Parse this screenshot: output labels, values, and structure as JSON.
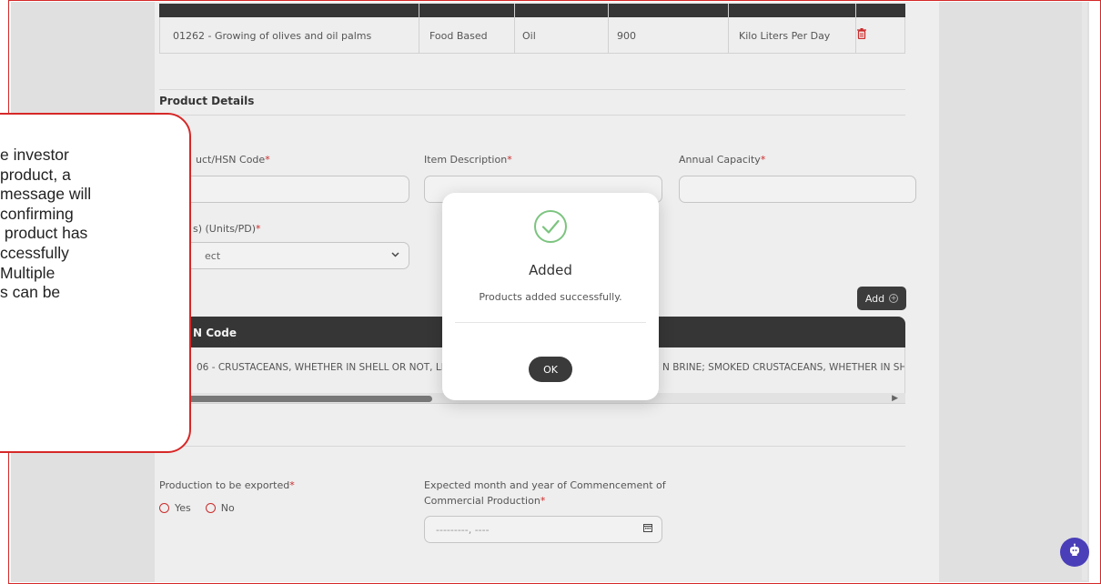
{
  "top_table": {
    "row": {
      "nic_code": "01262 - Growing of olives and oil palms",
      "category": "Food Based",
      "product": "Oil",
      "capacity": "900",
      "unit": "Kilo Liters Per Day"
    }
  },
  "product_details": {
    "title": "Product Details",
    "fields": {
      "hsn_label": "uct/HSN Code",
      "item_description_label": "Item Description",
      "annual_capacity_label": "Annual Capacity",
      "units_label": "s) (Units/PD)",
      "units_select_value": "ect",
      "required_marker": "*"
    },
    "add_button_label": "Add",
    "table": {
      "header": "N Code",
      "row_text_left": "06 - CRUSTACEANS, WHETHER IN SHELL OR NOT, LIVE,",
      "row_text_right": "N BRINE; SMOKED CRUSTACEANS, WHETHER IN SHELL C"
    }
  },
  "export": {
    "label": "Production to be exported",
    "options": [
      "Yes",
      "No"
    ]
  },
  "commencement": {
    "label_line1": "Expected month and year of Commencement of",
    "label_line2": "Commercial Production",
    "placeholder": "---------, ----"
  },
  "modal": {
    "title": "Added",
    "message": "Products added successfully.",
    "ok_label": "OK"
  },
  "callout": {
    "lines": [
      "e investor",
      "product, a",
      "message will",
      "confirming",
      " product has",
      "ccessfully",
      "Multiple",
      "s can be"
    ]
  },
  "colors": {
    "accent_red": "#d62828",
    "dark": "#333333",
    "success_green": "#7cc47f",
    "chat_purple": "#4a3fb8"
  }
}
